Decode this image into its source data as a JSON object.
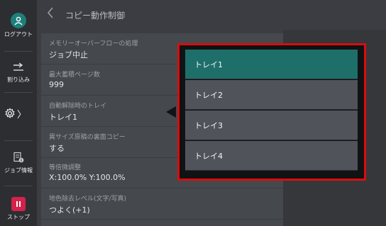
{
  "rail": {
    "logout_label": "ログアウト",
    "interrupt_label": "割り込み",
    "job_info_label": "ジョブ情報",
    "stop_label": "ストップ",
    "settings_arrow": "〉"
  },
  "header": {
    "back_icon": "chevron-left-icon",
    "title": "コピー動作制御"
  },
  "settings": [
    {
      "label": "メモリーオーバーフローの処理",
      "value": "ジョブ中止"
    },
    {
      "label": "最大蓄積ページ数",
      "value": "999"
    },
    {
      "label": "自動解除時のトレイ",
      "value": "トレイ1"
    },
    {
      "label": "異サイズ原稿の裏面コピー",
      "value": "する"
    },
    {
      "label": "等倍微調整",
      "value": "X:100.0%  Y:100.0%"
    },
    {
      "label": "地色除去レベル(文字/写真)",
      "value": "つよく(+1)"
    }
  ],
  "popup": {
    "options": [
      {
        "label": "トレイ1",
        "selected": true
      },
      {
        "label": "トレイ2",
        "selected": false
      },
      {
        "label": "トレイ3",
        "selected": false
      },
      {
        "label": "トレイ4",
        "selected": false
      }
    ]
  },
  "colors": {
    "accent": "#1e6f6a",
    "highlight_border": "#d90d0d",
    "stop": "#d3224b"
  }
}
